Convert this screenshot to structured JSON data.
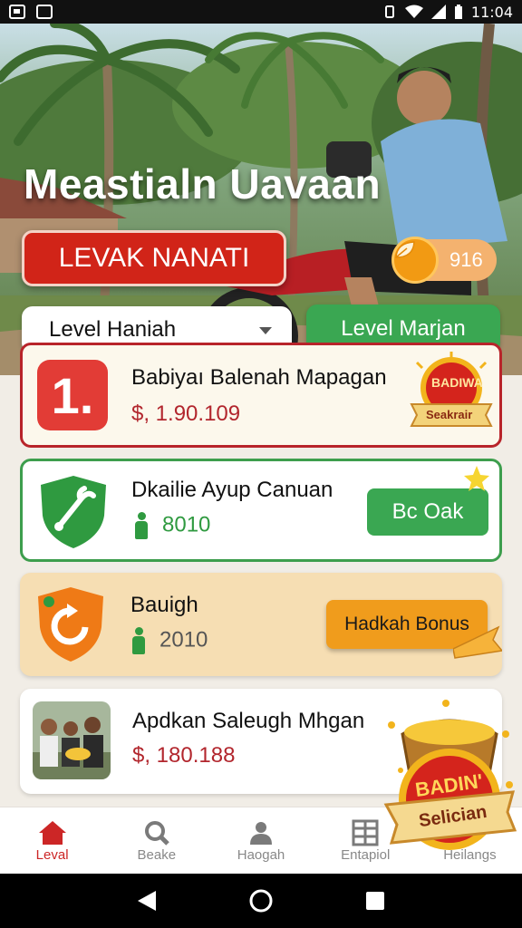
{
  "status_bar": {
    "time": "11:04"
  },
  "hero": {
    "title": "Meastialn Uavaan",
    "primary_button": "LEVAK NANATI",
    "coins": "916",
    "dropdown_value": "Level Haniah",
    "secondary_button": "Level Marjan"
  },
  "cards": [
    {
      "icon_text": "1.",
      "title": "Babiyaı Balenah Mapagan",
      "amount": "$, 1.90.109",
      "badge_line1": "BADIWA",
      "badge_line2": "Seakrair"
    },
    {
      "title": "Dkailie Ayup Canuan",
      "value": "8010",
      "button": "Bc Oak"
    },
    {
      "title": "Bauigh",
      "value": "2010",
      "button": "Hadkah Bonus"
    },
    {
      "title": "Apdkan Saleugh Mhgan",
      "amount": "$, 180.188",
      "badge_line1": "BADIN'",
      "badge_line2": "Selician"
    }
  ],
  "nav": [
    {
      "label": "Leval",
      "icon": "home-icon"
    },
    {
      "label": "Beake",
      "icon": "search-icon"
    },
    {
      "label": "Haogah",
      "icon": "person-icon"
    },
    {
      "label": "Entapiol",
      "icon": "grid-icon"
    },
    {
      "label": "Heilangs",
      "icon": "settings-icon"
    }
  ],
  "colors": {
    "primary_red": "#d12418",
    "green": "#3aa752",
    "orange": "#f09c1c",
    "gold": "#f29a13"
  }
}
